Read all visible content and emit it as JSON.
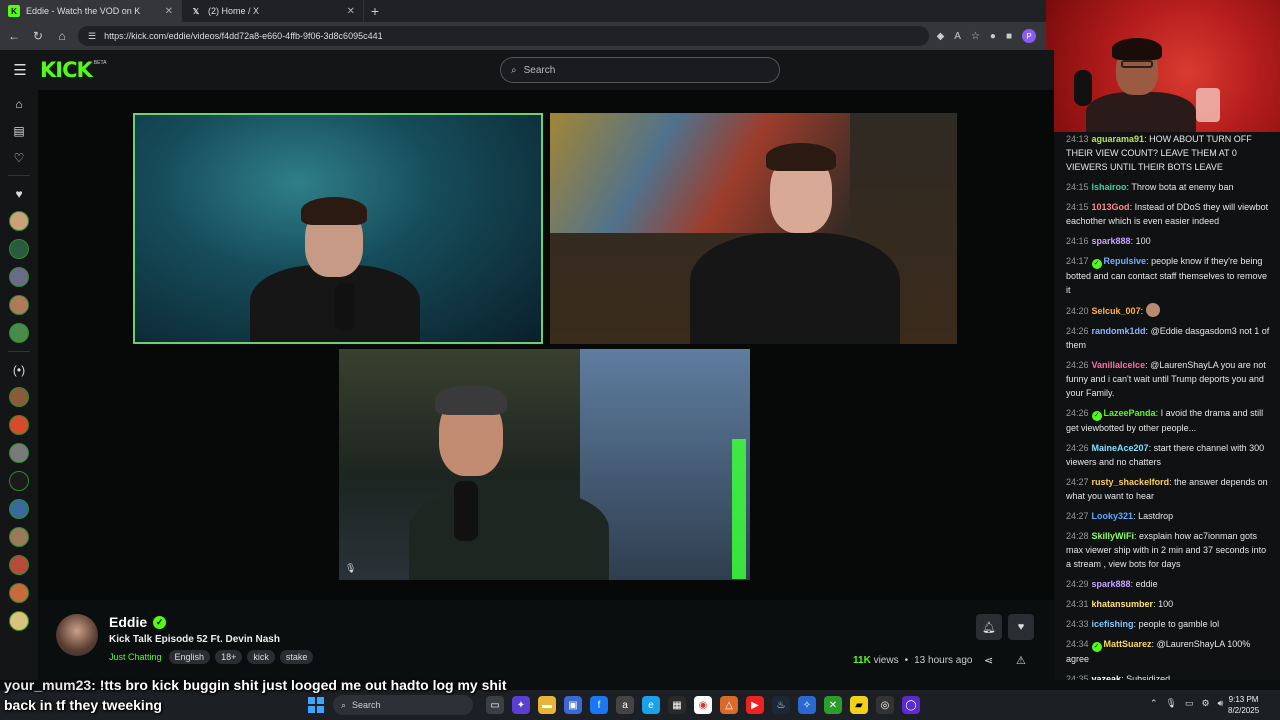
{
  "browser": {
    "tabs": [
      {
        "title": "Eddie - Watch the VOD on K",
        "favicon": "kick-favicon",
        "active": true
      },
      {
        "title": "(2) Home / X",
        "favicon": "x-favicon",
        "active": false
      }
    ],
    "new_tab": "+",
    "url": "https://kick.com/eddie/videos/f4dd72a8-e660-4ffb-9f06-3d8c6095c441",
    "profile_initial": "P"
  },
  "kick": {
    "logo": "KICK",
    "logo_badge": "BETA",
    "search_placeholder": "Search"
  },
  "channel": {
    "name": "Eddie",
    "title": "Kick Talk Episode 52 Ft. Devin Nash",
    "category": "Just Chatting",
    "tags": [
      "English",
      "18+",
      "kick",
      "stake"
    ],
    "views_count": "11K",
    "views_label": "views",
    "time_ago": "13 hours ago"
  },
  "chat": [
    {
      "time": "24:13",
      "user": "aguarama91",
      "color": "#b7e64f",
      "text": "HOW ABOUT TURN OFF THEIR VIEW COUNT? LEAVE THEM AT 0 VIEWERS UNTIL THEIR BOTS LEAVE",
      "badge": false
    },
    {
      "time": "24:15",
      "user": "lshairoo",
      "color": "#37d6a3",
      "text": "Throw bota at enemy ban",
      "badge": false
    },
    {
      "time": "24:15",
      "user": "1013God",
      "color": "#ff8a8a",
      "text": "Instead of DDoS they will viewbot eachother which is even easier indeed",
      "badge": false
    },
    {
      "time": "24:16",
      "user": "spark888",
      "color": "#c8a2ff",
      "text": "100",
      "badge": false
    },
    {
      "time": "24:17",
      "user": "Repulsive",
      "color": "#6fb2ff",
      "text": "people know if they're being botted and can contact staff themselves to remove it",
      "badge": true
    },
    {
      "time": "24:20",
      "user": "Selcuk_007",
      "color": "#ffb347",
      "text": "",
      "badge": false,
      "emote": true
    },
    {
      "time": "24:26",
      "user": "randomk1dd",
      "color": "#8ab4ff",
      "text": "@Eddie dasgasdom3 not 1 of them",
      "badge": false
    },
    {
      "time": "24:26",
      "user": "VanillaIcelce",
      "color": "#ff6fa8",
      "text": "@LaurenShayLA you are not funny and i can't wait until Trump deports you and your Family.",
      "badge": false
    },
    {
      "time": "24:26",
      "user": "LazeePanda",
      "color": "#53fc18",
      "text": "I avoid the drama and still get viewbotted by other people...",
      "badge": true
    },
    {
      "time": "24:26",
      "user": "MaineAce207",
      "color": "#7ee0ff",
      "text": "start there channel with 300 viewers and no chatters",
      "badge": false
    },
    {
      "time": "24:27",
      "user": "rusty_shackelford",
      "color": "#ffcf5c",
      "text": "the answer depends on what you want to hear",
      "badge": false
    },
    {
      "time": "24:27",
      "user": "Looky321",
      "color": "#5fa8ff",
      "text": "Lastdrop",
      "badge": false
    },
    {
      "time": "24:28",
      "user": "SkillyWiFi",
      "color": "#8cff66",
      "text": "exsplain how ac7ionman gots max viewer ship with in 2 min and 37 seconds into a stream , view bots for days",
      "badge": false
    },
    {
      "time": "24:29",
      "user": "spark888",
      "color": "#c8a2ff",
      "text": "eddie",
      "badge": false
    },
    {
      "time": "24:31",
      "user": "khatansumber",
      "color": "#ffe27a",
      "text": "100",
      "badge": false
    },
    {
      "time": "24:33",
      "user": "icefishing",
      "color": "#7ec8ff",
      "text": "people to gamble lol",
      "badge": false
    },
    {
      "time": "24:34",
      "user": "MattSuarez",
      "color": "#ffd75e",
      "text": "@LaurenShayLA 100% agree",
      "badge": true
    },
    {
      "time": "24:35",
      "user": "vazeak",
      "color": "#ffffff",
      "text": "Subsidized",
      "badge": false
    }
  ],
  "tts": {
    "user": "your_mum23",
    "message": ": !tts bro kick buggin shit just looged me out hadto log my shit back in tf they tweeking"
  },
  "taskbar": {
    "search_placeholder": "Search",
    "time": "9:13 PM",
    "date": "8/2/2025"
  },
  "colors": {
    "kick_green": "#53fc18",
    "bg": "#0b0e0f"
  }
}
